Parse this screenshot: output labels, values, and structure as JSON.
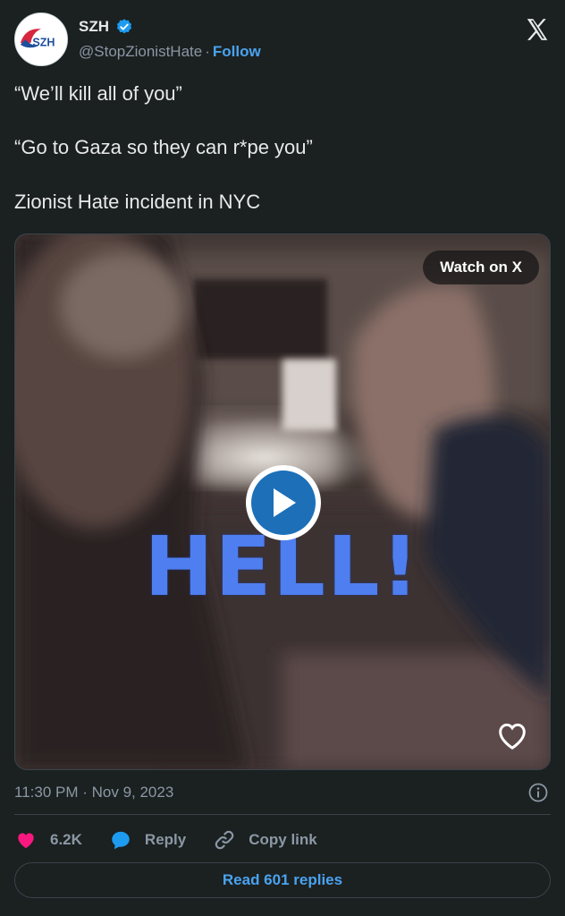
{
  "author": {
    "display_name": "SZH",
    "handle": "@StopZionistHate",
    "separator": "·",
    "follow_label": "Follow",
    "avatar_text": "SZH",
    "verified": true
  },
  "tweet": {
    "lines": [
      "“We’ll kill all of you”",
      "“Go to Gaza so they can r*pe you”",
      "Zionist Hate incident in NYC"
    ]
  },
  "media": {
    "watch_label": "Watch on X",
    "overlay_text": "HELL!",
    "play_icon": "play-icon"
  },
  "meta": {
    "timestamp": "11:30 PM · Nov 9, 2023"
  },
  "actions": {
    "likes": "6.2K",
    "reply_label": "Reply",
    "copy_label": "Copy link"
  },
  "replies_button": "Read 601 replies",
  "colors": {
    "background": "#1b2020",
    "accent": "#4aa3f0",
    "like": "#f91880",
    "overlay_text": "#4e7ef0"
  }
}
